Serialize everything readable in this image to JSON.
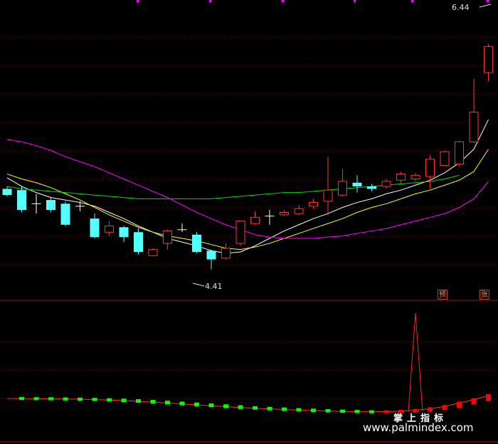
{
  "colors": {
    "background": "#000000",
    "grid": "#7a1010",
    "up": "#ff3232",
    "down": "#54ffff",
    "ma_white": "#ffffff",
    "ma_yellow": "#ffff00",
    "ma_magenta": "#ff00ff",
    "ma_green": "#00dd00",
    "marker_magenta": "#ff00ff"
  },
  "labels": {
    "high": "6.44",
    "low": "4.41",
    "badge_yu": "预",
    "badge_zhang": "张"
  },
  "watermark": {
    "title": "掌上指标",
    "url": "www.palmindex.com"
  },
  "chart_data": {
    "type": "candlestick",
    "ylim": [
      4.2,
      6.5
    ],
    "y_high_label": 6.44,
    "y_low_label": 4.41,
    "candles": [
      {
        "o": 5.06,
        "c": 5.01,
        "h": 5.08,
        "l": 5.0
      },
      {
        "o": 5.05,
        "c": 4.89,
        "h": 5.08,
        "l": 4.87
      },
      {
        "o": 4.94,
        "c": 4.94,
        "h": 5.02,
        "l": 4.86
      },
      {
        "o": 4.97,
        "c": 4.89,
        "h": 4.99,
        "l": 4.87
      },
      {
        "o": 4.94,
        "c": 4.77,
        "h": 4.96,
        "l": 4.76
      },
      {
        "o": 4.92,
        "c": 4.92,
        "h": 4.96,
        "l": 4.88
      },
      {
        "o": 4.82,
        "c": 4.67,
        "h": 4.86,
        "l": 4.66
      },
      {
        "o": 4.71,
        "c": 4.76,
        "h": 4.8,
        "l": 4.68
      },
      {
        "o": 4.75,
        "c": 4.67,
        "h": 4.76,
        "l": 4.63
      },
      {
        "o": 4.71,
        "c": 4.55,
        "h": 4.74,
        "l": 4.53
      },
      {
        "o": 4.52,
        "c": 4.57,
        "h": 4.58,
        "l": 4.52
      },
      {
        "o": 4.62,
        "c": 4.72,
        "h": 4.73,
        "l": 4.57
      },
      {
        "o": 4.73,
        "c": 4.73,
        "h": 4.78,
        "l": 4.71
      },
      {
        "o": 4.69,
        "c": 4.55,
        "h": 4.71,
        "l": 4.54
      },
      {
        "o": 4.56,
        "c": 4.49,
        "h": 4.57,
        "l": 4.41
      },
      {
        "o": 4.5,
        "c": 4.58,
        "h": 4.62,
        "l": 4.49
      },
      {
        "o": 4.62,
        "c": 4.8,
        "h": 4.8,
        "l": 4.6
      },
      {
        "o": 4.78,
        "c": 4.83,
        "h": 4.88,
        "l": 4.77
      },
      {
        "o": 4.84,
        "c": 4.84,
        "h": 4.89,
        "l": 4.77
      },
      {
        "o": 4.85,
        "c": 4.87,
        "h": 4.89,
        "l": 4.84
      },
      {
        "o": 4.86,
        "c": 4.9,
        "h": 4.93,
        "l": 4.85
      },
      {
        "o": 4.92,
        "c": 4.95,
        "h": 4.98,
        "l": 4.9
      },
      {
        "o": 4.96,
        "c": 5.05,
        "h": 5.32,
        "l": 4.85
      },
      {
        "o": 5.01,
        "c": 5.12,
        "h": 5.22,
        "l": 5.0
      },
      {
        "o": 5.11,
        "c": 5.08,
        "h": 5.17,
        "l": 5.03
      },
      {
        "o": 5.08,
        "c": 5.06,
        "h": 5.1,
        "l": 5.04
      },
      {
        "o": 5.08,
        "c": 5.12,
        "h": 5.14,
        "l": 5.06
      },
      {
        "o": 5.13,
        "c": 5.18,
        "h": 5.2,
        "l": 5.1
      },
      {
        "o": 5.14,
        "c": 5.17,
        "h": 5.19,
        "l": 5.12
      },
      {
        "o": 5.16,
        "c": 5.3,
        "h": 5.33,
        "l": 5.06
      },
      {
        "o": 5.25,
        "c": 5.36,
        "h": 5.37,
        "l": 5.25
      },
      {
        "o": 5.26,
        "c": 5.44,
        "h": 5.45,
        "l": 5.24
      },
      {
        "o": 5.44,
        "c": 5.68,
        "h": 5.95,
        "l": 5.43
      },
      {
        "o": 6.0,
        "c": 6.21,
        "h": 6.23,
        "l": 5.93
      }
    ],
    "ma_series": [
      {
        "color": "ma_white",
        "values": [
          5.15,
          5.08,
          5.03,
          4.99,
          4.97,
          4.95,
          4.92,
          4.87,
          4.82,
          4.76,
          4.71,
          4.66,
          4.63,
          4.6,
          4.56,
          4.54,
          4.55,
          4.6,
          4.66,
          4.72,
          4.77,
          4.82,
          4.86,
          4.91,
          4.95,
          4.98,
          5.02,
          5.05,
          5.09,
          5.13,
          5.19,
          5.27,
          5.38,
          5.62
        ]
      },
      {
        "color": "ma_yellow",
        "values": [
          5.18,
          5.14,
          5.11,
          5.07,
          5.02,
          4.97,
          4.91,
          4.85,
          4.8,
          4.75,
          4.71,
          4.68,
          4.66,
          4.64,
          4.61,
          4.58,
          4.57,
          4.59,
          4.62,
          4.66,
          4.7,
          4.74,
          4.78,
          4.82,
          4.87,
          4.91,
          4.94,
          4.98,
          5.02,
          5.05,
          5.09,
          5.13,
          5.2,
          5.38
        ]
      },
      {
        "color": "ma_magenta",
        "values": [
          5.46,
          5.44,
          5.41,
          5.37,
          5.32,
          5.28,
          5.24,
          5.19,
          5.14,
          5.09,
          5.04,
          4.99,
          4.93,
          4.87,
          4.82,
          4.77,
          4.73,
          4.69,
          4.67,
          4.66,
          4.66,
          4.66,
          4.67,
          4.68,
          4.7,
          4.72,
          4.74,
          4.77,
          4.8,
          4.83,
          4.86,
          4.91,
          4.98,
          5.12
        ]
      },
      {
        "color": "ma_green",
        "values": [
          5.08,
          5.06,
          5.05,
          5.04,
          5.03,
          5.02,
          5.01,
          5.0,
          4.99,
          4.98,
          4.98,
          4.98,
          4.98,
          4.98,
          4.98,
          4.99,
          5.0,
          5.01,
          5.02,
          5.03,
          5.03,
          5.04,
          5.05,
          5.06,
          5.07,
          5.08,
          5.09,
          5.1,
          5.11,
          5.12,
          5.14,
          5.17
        ]
      }
    ],
    "indicator": {
      "ylim": [
        0,
        100
      ],
      "line": [
        25,
        24.9,
        24.8,
        24.7,
        24.5,
        24.3,
        24.0,
        23.6,
        23.1,
        22.5,
        21.8,
        21.0,
        20.2,
        19.4,
        18.6,
        17.8,
        17.0,
        16.4,
        15.8,
        15.3,
        14.8,
        14.4,
        14.0,
        13.7,
        13.4,
        13.3,
        13.4,
        13.8,
        14.6,
        16.0,
        18.0,
        21.0,
        24.0,
        27.5
      ],
      "spike_index": 28,
      "spike_value": 100
    }
  }
}
